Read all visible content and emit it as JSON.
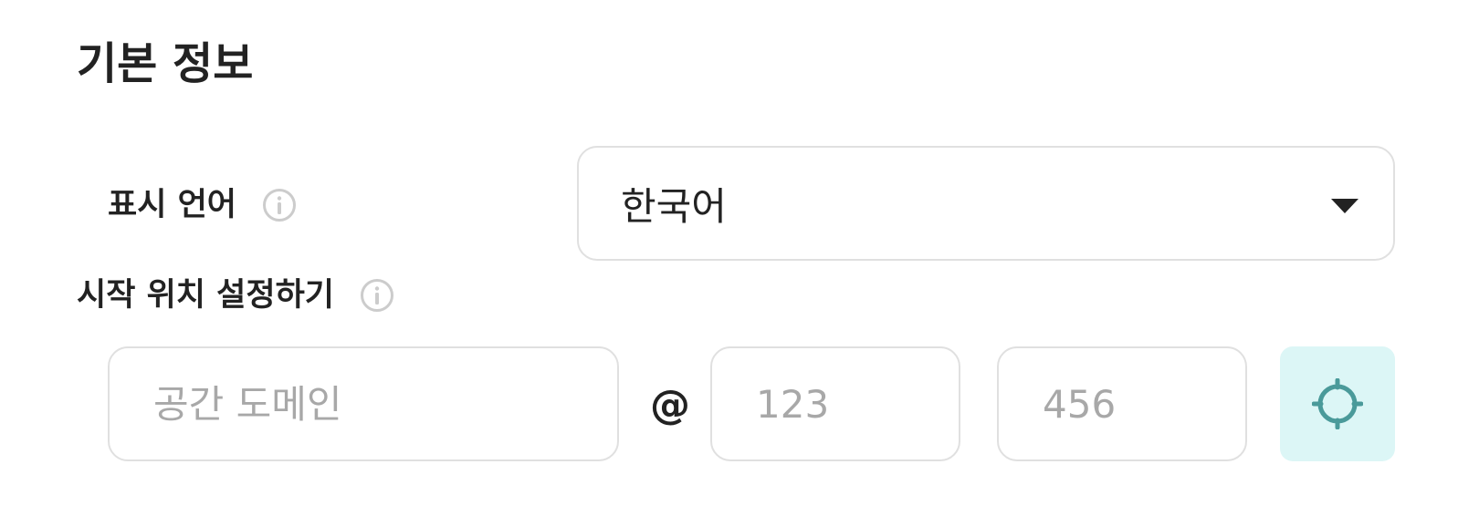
{
  "section": {
    "title": "기본 정보"
  },
  "display_language": {
    "label": "표시 언어",
    "info_icon": "info-circle-icon",
    "selected": "한국어",
    "arrow_icon": "caret-down-icon"
  },
  "start_location": {
    "label": "시작 위치 설정하기",
    "info_icon": "info-circle-icon",
    "domain_placeholder": "공간 도메인",
    "at_symbol": "@",
    "x_placeholder": "123",
    "y_placeholder": "456",
    "locate_icon": "crosshair-icon"
  },
  "colors": {
    "text": "#222222",
    "border": "#e0e0e0",
    "placeholder": "#a8a8a8",
    "accent": "#4a9a9a",
    "accent_bg": "#dcf6f6",
    "info_icon": "#cccccc"
  }
}
